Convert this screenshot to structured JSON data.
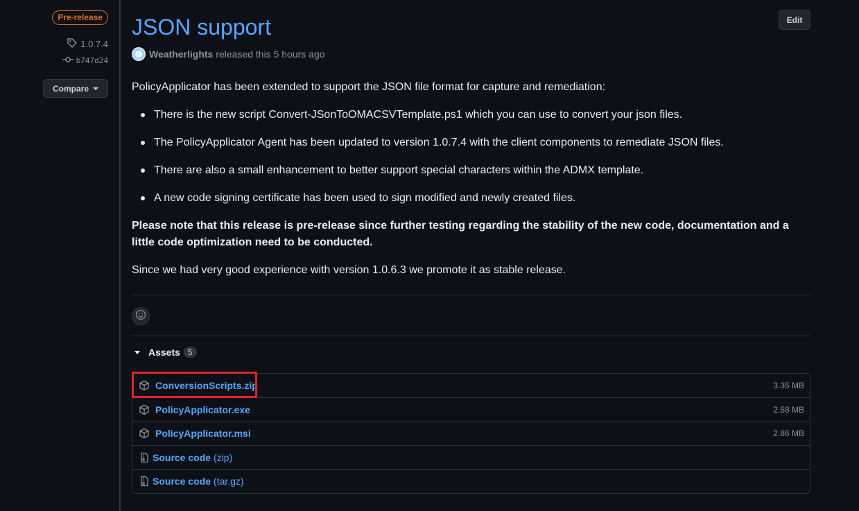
{
  "sidebar": {
    "badge": "Pre-release",
    "tag": "1.0.7.4",
    "commit": "b747d24",
    "compare_label": "Compare"
  },
  "release": {
    "title": "JSON support",
    "author": "Weatherlights",
    "released_text": "released this 5 hours ago",
    "edit_label": "Edit",
    "intro": "PolicyApplicator has been extended to support the JSON file format for capture and remediation:",
    "bullets": [
      "There is the new script Convert-JSonToOMACSVTemplate.ps1 which you can use to convert your json files.",
      "The PolicyApplicator Agent has been updated to version 1.0.7.4 with the client components to remediate JSON files.",
      "There are also a small enhancement to better support special characters within the ADMX template.",
      "A new code signing certificate has been used to sign modified and newly created files."
    ],
    "note": "Please note that this release is pre-release since further testing regarding the stability of the new code, documentation and a little code optimization need to be conducted.",
    "closing": "Since we had very good experience with version 1.0.6.3 we promote it as stable release."
  },
  "assets": {
    "heading": "Assets",
    "count": "5",
    "files": [
      {
        "name": "ConversionScripts.zip",
        "size": "3.35 MB"
      },
      {
        "name": "PolicyApplicator.exe",
        "size": "2.58 MB"
      },
      {
        "name": "PolicyApplicator.msi",
        "size": "2.86 MB"
      }
    ],
    "sources": [
      {
        "name": "Source code",
        "ext": "(zip)"
      },
      {
        "name": "Source code",
        "ext": "(tar.gz)"
      }
    ]
  },
  "colors": {
    "background": "#0d1117",
    "link": "#58a6ff",
    "prerelease_badge": "#db6d28",
    "highlight_box": "#e0242b"
  }
}
